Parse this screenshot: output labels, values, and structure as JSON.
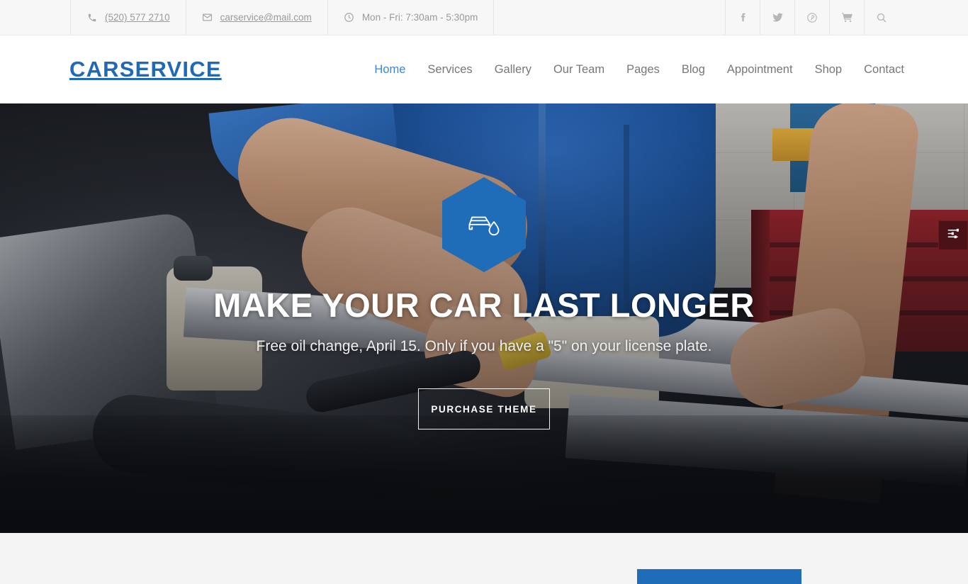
{
  "topbar": {
    "phone": {
      "icon": "phone-icon",
      "text": "(520) 577 2710"
    },
    "email": {
      "icon": "envelope-icon",
      "text": "carservice@mail.com"
    },
    "hours": {
      "icon": "clock-icon",
      "text": "Mon - Fri: 7:30am - 5:30pm"
    },
    "social": [
      {
        "name": "facebook-icon",
        "label": "Facebook"
      },
      {
        "name": "twitter-icon",
        "label": "Twitter"
      },
      {
        "name": "pinterest-icon",
        "label": "Pinterest"
      },
      {
        "name": "cart-icon",
        "label": "Cart"
      },
      {
        "name": "search-icon",
        "label": "Search"
      }
    ]
  },
  "header": {
    "logo": "CARSERVICE",
    "nav": [
      {
        "label": "Home",
        "active": true
      },
      {
        "label": "Services",
        "active": false
      },
      {
        "label": "Gallery",
        "active": false
      },
      {
        "label": "Our Team",
        "active": false
      },
      {
        "label": "Pages",
        "active": false
      },
      {
        "label": "Blog",
        "active": false
      },
      {
        "label": "Appointment",
        "active": false
      },
      {
        "label": "Shop",
        "active": false
      },
      {
        "label": "Contact",
        "active": false
      }
    ]
  },
  "hero": {
    "badge_icon": "car-oil-drop-icon",
    "title": "MAKE YOUR CAR LAST LONGER",
    "subtitle": "Free oil change, April 15. Only if you have a \"5\" on your license plate.",
    "cta_label": "PURCHASE THEME"
  },
  "settings_tab": {
    "icon": "sliders-icon",
    "label": "Theme Settings"
  },
  "colors": {
    "brand_blue": "#1f6cb8",
    "nav_active": "#3a87d8",
    "topbar_bg": "#f7f7f7",
    "section_bg": "#f4f4f4",
    "settings_tab_bg": "#4a1216"
  }
}
